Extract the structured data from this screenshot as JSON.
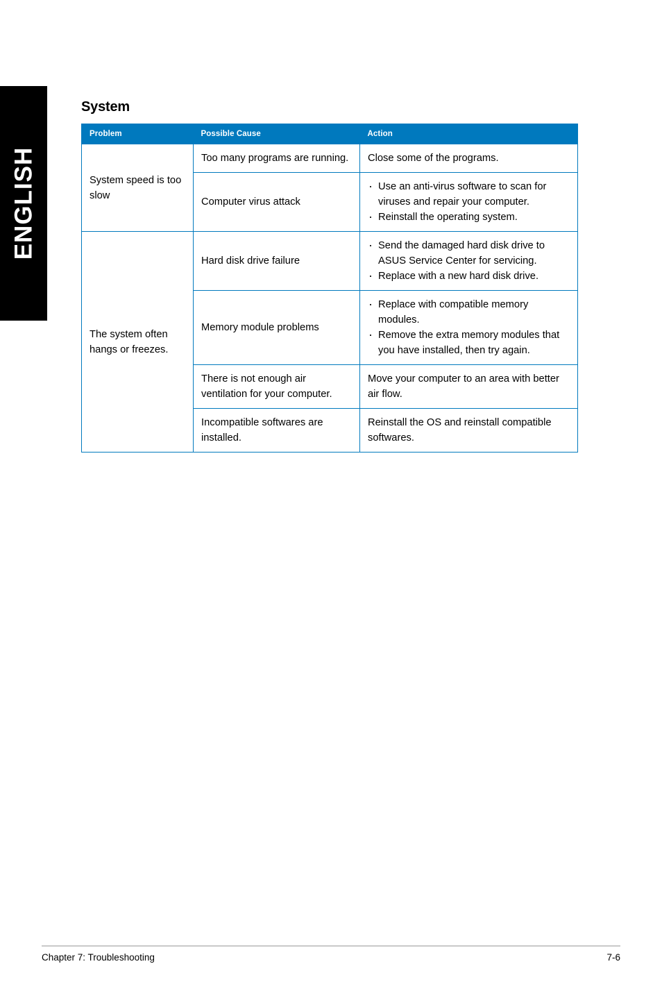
{
  "language_tab": {
    "label": "ENGLISH"
  },
  "page": {
    "title": "System"
  },
  "table": {
    "headers": {
      "problem": "Problem",
      "possible_cause": "Possible Cause",
      "action": "Action"
    },
    "groups": [
      {
        "problem": "System speed is too slow",
        "rows": [
          {
            "possible_cause": "Too many programs are running.",
            "action_type": "text",
            "action_text": "Close some of the programs."
          },
          {
            "possible_cause": "Computer virus attack",
            "action_type": "list",
            "action_items": [
              "Use an anti-virus software to scan for viruses and repair your computer.",
              "Reinstall the operating system."
            ]
          }
        ]
      },
      {
        "problem": "The system often hangs or freezes.",
        "rows": [
          {
            "possible_cause": "Hard disk drive failure",
            "action_type": "list",
            "action_items": [
              "Send the damaged hard disk drive to ASUS Service Center for servicing.",
              "Replace with a new hard disk drive."
            ]
          },
          {
            "possible_cause": "Memory module problems",
            "action_type": "list",
            "action_items": [
              "Replace with compatible memory modules.",
              "Remove the extra memory modules that you have installed, then try again."
            ]
          },
          {
            "possible_cause": "There is not enough air ventilation for your computer.",
            "action_type": "text",
            "action_text": "Move your computer to an area with better air flow."
          },
          {
            "possible_cause": "Incompatible softwares are installed.",
            "action_type": "text",
            "action_text": "Reinstall the OS and reinstall compatible softwares."
          }
        ]
      }
    ]
  },
  "footer": {
    "chapter": "Chapter 7: Troubleshooting",
    "page_number": "7-6"
  },
  "colors": {
    "accent_blue": "#0079be",
    "tab_black": "#000000",
    "rule_gray": "#c9c9c9"
  }
}
